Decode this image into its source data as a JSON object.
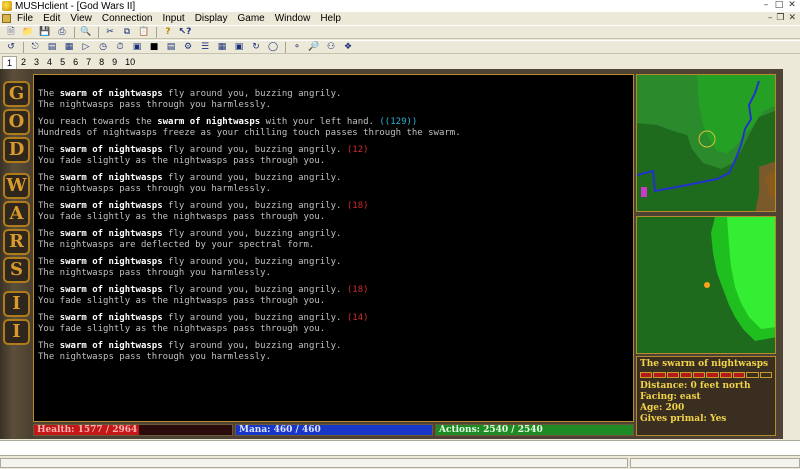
{
  "window": {
    "title": "MUSHclient - [God Wars II]"
  },
  "menu": [
    "File",
    "Edit",
    "View",
    "Connection",
    "Input",
    "Display",
    "Game",
    "Window",
    "Help"
  ],
  "tabs": [
    "1",
    "2",
    "3",
    "4",
    "5",
    "6",
    "7",
    "8",
    "9",
    "10"
  ],
  "active_tab": "1",
  "banner_title": "GOD WARS II",
  "output_lines": [
    {
      "parts": [
        {
          "t": "The "
        },
        {
          "t": "swarm of nightwasps",
          "c": "b"
        },
        {
          "t": " fly around you, buzzing angrily."
        }
      ]
    },
    {
      "parts": [
        {
          "t": "The nightwasps pass through you harmlessly."
        }
      ]
    },
    {
      "gap": true
    },
    {
      "parts": [
        {
          "t": "You reach towards the "
        },
        {
          "t": "swarm of nightwasps",
          "c": "b"
        },
        {
          "t": " with your left hand. "
        },
        {
          "t": "((129))",
          "c": "heal"
        }
      ]
    },
    {
      "parts": [
        {
          "t": "Hundreds of nightwasps freeze as your chilling touch passes through the swarm."
        }
      ]
    },
    {
      "gap": true
    },
    {
      "parts": [
        {
          "t": "The "
        },
        {
          "t": "swarm of nightwasps",
          "c": "b"
        },
        {
          "t": " fly around you, buzzing angrily. "
        },
        {
          "t": "(12)",
          "c": "dmg"
        }
      ]
    },
    {
      "parts": [
        {
          "t": "You fade slightly as the nightwasps pass through you."
        }
      ]
    },
    {
      "gap": true
    },
    {
      "parts": [
        {
          "t": "The "
        },
        {
          "t": "swarm of nightwasps",
          "c": "b"
        },
        {
          "t": " fly around you, buzzing angrily."
        }
      ]
    },
    {
      "parts": [
        {
          "t": "The nightwasps pass through you harmlessly."
        }
      ]
    },
    {
      "gap": true
    },
    {
      "parts": [
        {
          "t": "The "
        },
        {
          "t": "swarm of nightwasps",
          "c": "b"
        },
        {
          "t": " fly around you, buzzing angrily. "
        },
        {
          "t": "(18)",
          "c": "dmg"
        }
      ]
    },
    {
      "parts": [
        {
          "t": "You fade slightly as the nightwasps pass through you."
        }
      ]
    },
    {
      "gap": true
    },
    {
      "parts": [
        {
          "t": "The "
        },
        {
          "t": "swarm of nightwasps",
          "c": "b"
        },
        {
          "t": " fly around you, buzzing angrily."
        }
      ]
    },
    {
      "parts": [
        {
          "t": "The nightwasps are deflected by your spectral form."
        }
      ]
    },
    {
      "gap": true
    },
    {
      "parts": [
        {
          "t": "The "
        },
        {
          "t": "swarm of nightwasps",
          "c": "b"
        },
        {
          "t": " fly around you, buzzing angrily."
        }
      ]
    },
    {
      "parts": [
        {
          "t": "The nightwasps pass through you harmlessly."
        }
      ]
    },
    {
      "gap": true
    },
    {
      "parts": [
        {
          "t": "The "
        },
        {
          "t": "swarm of nightwasps",
          "c": "b"
        },
        {
          "t": " fly around you, buzzing angrily. "
        },
        {
          "t": "(18)",
          "c": "dmg"
        }
      ]
    },
    {
      "parts": [
        {
          "t": "You fade slightly as the nightwasps pass through you."
        }
      ]
    },
    {
      "gap": true
    },
    {
      "parts": [
        {
          "t": "The "
        },
        {
          "t": "swarm of nightwasps",
          "c": "b"
        },
        {
          "t": " fly around you, buzzing angrily. "
        },
        {
          "t": "(14)",
          "c": "dmg"
        }
      ]
    },
    {
      "parts": [
        {
          "t": "You fade slightly as the nightwasps pass through you."
        }
      ]
    },
    {
      "gap": true
    },
    {
      "parts": [
        {
          "t": "The "
        },
        {
          "t": "swarm of nightwasps",
          "c": "b"
        },
        {
          "t": " fly around you, buzzing angrily."
        }
      ]
    },
    {
      "parts": [
        {
          "t": "The nightwasps pass through you harmlessly."
        }
      ]
    }
  ],
  "status": {
    "health": {
      "label": "Health: 1577 / 2964",
      "fraction": 0.53
    },
    "mana": {
      "label": "Mana: 460 / 460",
      "fraction": 1.0
    },
    "actions": {
      "label": "Actions: 2540 / 2540",
      "fraction": 1.0
    }
  },
  "target": {
    "name": "The swarm of nightwasps",
    "hp_segments_total": 10,
    "hp_segments_filled": 8,
    "distance": "Distance: 0 feet north",
    "facing": "Facing: east",
    "age": "Age: 200",
    "primal": "Gives primal: Yes"
  },
  "colors": {
    "health": "#c21818",
    "mana": "#1836c8",
    "actions": "#1f8b25",
    "gold_text": "#f2d44a",
    "damage": "#d02a2a",
    "healing": "#2fb3d6"
  },
  "icons": {
    "toolbar1": [
      "new-icon",
      "open-icon",
      "save-icon",
      "print-icon",
      "preview-icon",
      "cut-icon",
      "copy-icon",
      "paste-icon",
      "help-icon",
      "context-help-icon"
    ],
    "toolbar2": [
      "connect-icon",
      "disconnect-icon",
      "log-icon",
      "notepad-icon",
      "triggers-icon",
      "aliases-icon",
      "timers-icon",
      "variables-icon",
      "world-icon",
      "scripts-icon",
      "config-icon",
      "list-icon",
      "table-icon",
      "map-icon",
      "reload-icon",
      "run-icon",
      "stop-icon",
      "find-icon",
      "tools-icon"
    ]
  }
}
